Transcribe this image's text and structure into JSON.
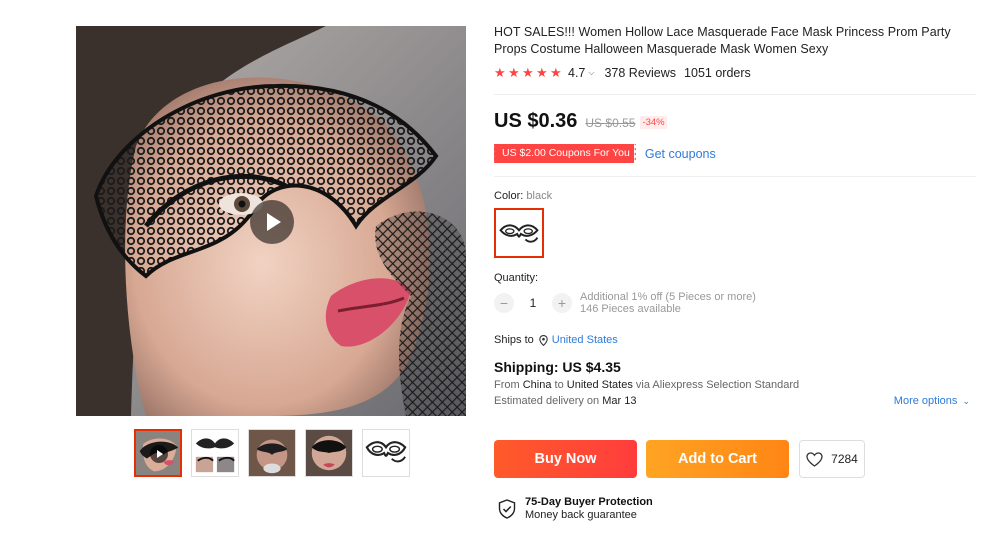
{
  "product": {
    "title": "HOT SALES!!! Women Hollow Lace Masquerade Face Mask Princess Prom Party Props Costume Halloween Masquerade Mask Women Sexy",
    "rating": "4.7",
    "reviews": "378 Reviews",
    "orders": "1051 orders"
  },
  "price": {
    "current": "US $0.36",
    "original": "US $0.55",
    "discount": "-34%"
  },
  "coupon": {
    "tag": "US $2.00 Coupons For You",
    "link": "Get coupons"
  },
  "color": {
    "label": "Color:",
    "selected": "black"
  },
  "quantity": {
    "label": "Quantity:",
    "value": "1",
    "minus": "−",
    "plus": "+",
    "note": "Additional 1% off (5 Pieces or more)",
    "available": "146 Pieces available"
  },
  "ships_to": {
    "label": "Ships to",
    "country": "United States"
  },
  "shipping": {
    "title": "Shipping: US $4.35",
    "from_prefix": "From",
    "from": "China",
    "to_prefix": "to",
    "to": "United States",
    "via": "via Aliexpress Selection Standard",
    "delivery_prefix": "Estimated delivery on",
    "delivery_date": "Mar 13",
    "more_options": "More options"
  },
  "actions": {
    "buy_now": "Buy Now",
    "add_to_cart": "Add to Cart",
    "wishlist_count": "7284"
  },
  "protection": {
    "title": "75-Day Buyer Protection",
    "subtitle": "Money back guarantee"
  },
  "colors": {
    "accent": "#ff4747",
    "link": "#2e7bd8",
    "buy": "#ff4a2c",
    "cart": "#ff9519"
  },
  "icons": [
    "play-icon",
    "star-icon",
    "chevron-down-icon",
    "location-pin-icon",
    "heart-icon",
    "shield-check-icon"
  ]
}
